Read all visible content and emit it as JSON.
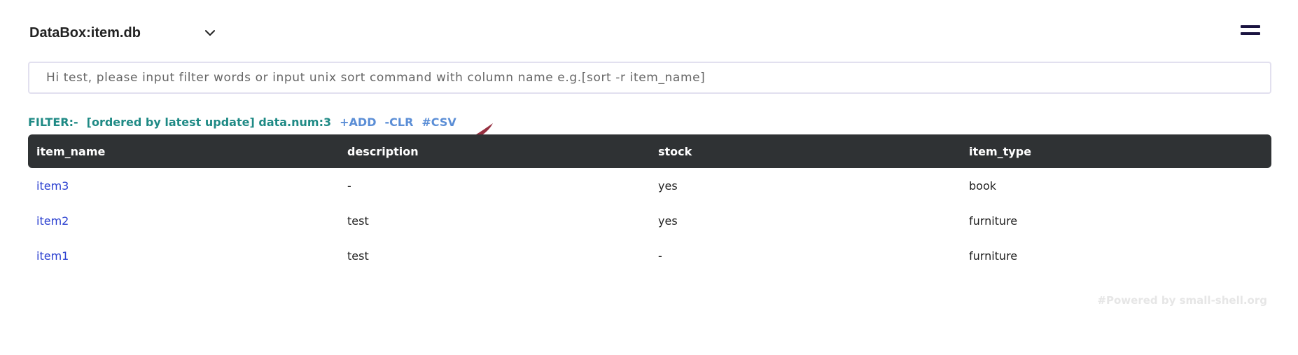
{
  "header": {
    "db_title": "DataBox:item.db",
    "chevron_icon": "chevron-down-icon",
    "menu_icon": "hamburger-menu-icon"
  },
  "search": {
    "placeholder": "Hi test, please input filter words or input unix sort command with column name e.g.[sort -r item_name]",
    "value": ""
  },
  "filter": {
    "label": "FILTER:-",
    "info": "[ordered by latest update] data.num:3",
    "add_label": "+ADD",
    "clr_label": "-CLR",
    "csv_label": "#CSV"
  },
  "table": {
    "headers": [
      "item_name",
      "description",
      "stock",
      "item_type"
    ],
    "rows": [
      [
        "item3",
        "-",
        "yes",
        "book"
      ],
      [
        "item2",
        "test",
        "yes",
        "furniture"
      ],
      [
        "item1",
        "test",
        "-",
        "furniture"
      ]
    ]
  },
  "footer": {
    "text": "#Powered by small-shell.org"
  },
  "colors": {
    "teal": "#1f8a85",
    "link_blue": "#5b8ed6",
    "item_link": "#2a3fd0",
    "table_header_bg": "#2f3234",
    "brush_mark": "#8b1a2b"
  }
}
